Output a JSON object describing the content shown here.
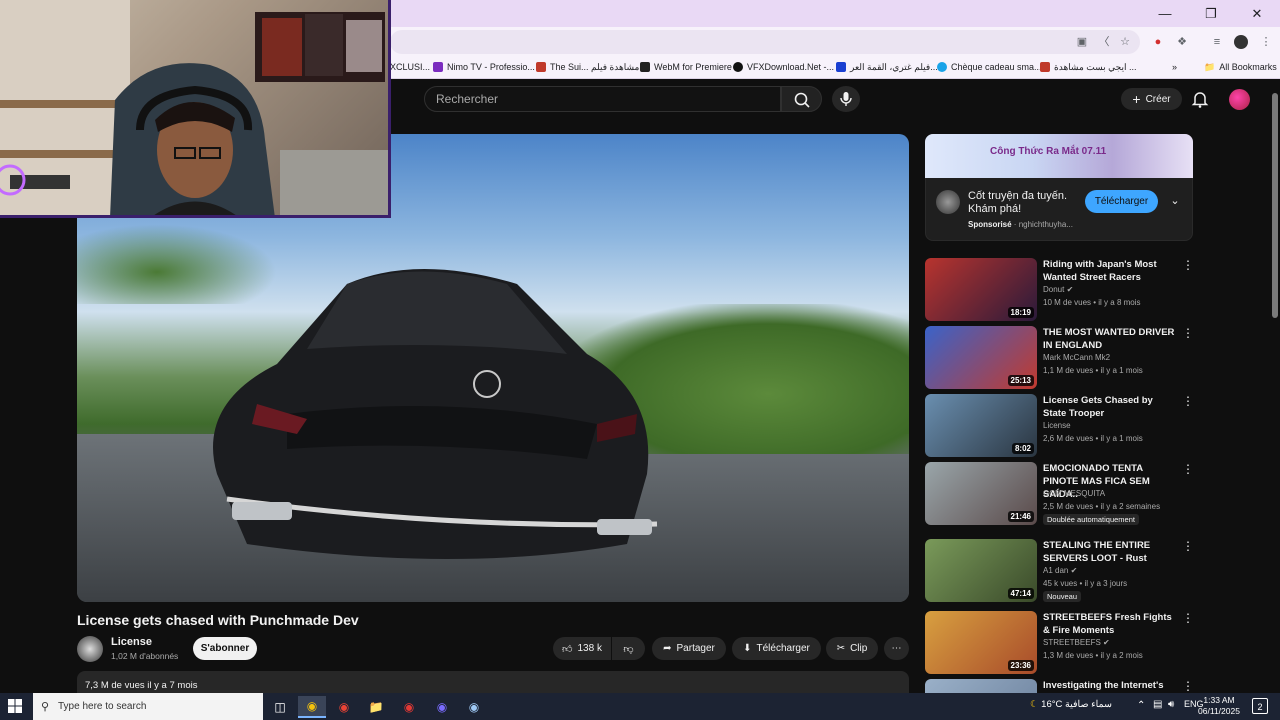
{
  "browser": {
    "bookmarks": [
      {
        "label": "XCLUSI...",
        "color": "#888888"
      },
      {
        "label": "Nimo TV - Professio...",
        "color": "#7b2cbf"
      },
      {
        "label": "The Sui... مشاهدة فيلم",
        "color": "#c0392b"
      },
      {
        "label": "WebM for Premiere",
        "color": "#222222"
      },
      {
        "label": "VFXDownload.Net -...",
        "color": "#111111"
      },
      {
        "label": "فيلم غتري، القمة العر...",
        "color": "#1a3fd1"
      },
      {
        "label": "Chèque cadeau sma...",
        "color": "#1aa3e8"
      },
      {
        "label": "ايجي بست مشاهدة ...",
        "color": "#c0392b"
      }
    ],
    "all_bookmarks_label": "All Bookmarks"
  },
  "header": {
    "search_placeholder": "Rechercher",
    "create_label": "Créer"
  },
  "video": {
    "title": "License gets chased with Punchmade Dev",
    "channel": "License",
    "subscribers": "1,02 M d'abonnés",
    "subscribe_label": "S'abonner",
    "likes": "138 k",
    "share_label": "Partager",
    "download_label": "Télécharger",
    "clip_label": "Clip",
    "stats": "7,3 M de vues  il y a 7 mois"
  },
  "ad": {
    "banner_text": "Công Thức Ra Mắt 07.11",
    "title": "Cốt truyện đa tuyến. Khám phá!",
    "sponsored": "Sponsorisé",
    "domain": "nghichthuyha...",
    "button_label": "Télécharger"
  },
  "recommendations": [
    {
      "title": "Riding with Japan's Most Wanted Street Racers",
      "channel": "Donut ✔",
      "meta": "10 M de vues • il y a 8 mois",
      "duration": "18:19",
      "badge": "",
      "thumb": "#b8342e"
    },
    {
      "title": "THE MOST WANTED DRIVER IN ENGLAND",
      "channel": "Mark McCann Mk2",
      "meta": "1,1 M de vues • il y a 1 mois",
      "duration": "25:13",
      "badge": "",
      "thumb": "#3a63c9"
    },
    {
      "title": "License Gets Chased by State Trooper",
      "channel": "License",
      "meta": "2,6 M de vues • il y a 1 mois",
      "duration": "8:02",
      "badge": "",
      "thumb": "#48657a"
    },
    {
      "title": "EMOCIONADO TENTA PINOTE MAS FICA SEM SAÍDA..",
      "channel": "GCM MESQUITA",
      "meta": "2,5 M de vues • il y a 2 semaines",
      "duration": "21:46",
      "badge": "Doublée automatiquement",
      "thumb": "#7c8a8f"
    },
    {
      "title": "STEALING THE ENTIRE SERVERS LOOT - Rust",
      "channel": "A1 dan ✔",
      "meta": "45 k vues • il y a 3 jours",
      "duration": "47:14",
      "badge": "Nouveau",
      "thumb": "#4d6a3a"
    },
    {
      "title": "STREETBEEFS Fresh Fights & Fire Moments",
      "channel": "STREETBEEFS ✔",
      "meta": "1,3 M de vues • il y a 2 mois",
      "duration": "23:36",
      "badge": "",
      "thumb": "#a84b2a"
    },
    {
      "title": "Investigating the Internet's",
      "channel": "",
      "meta": "",
      "duration": "",
      "badge": "",
      "thumb": "#6a7f9b"
    }
  ],
  "taskbar": {
    "search_placeholder": "Type here to search",
    "weather": "16°C  سماء صافية",
    "time": "1:33 AM",
    "date": "06/11/2025",
    "notification_count": "2"
  }
}
